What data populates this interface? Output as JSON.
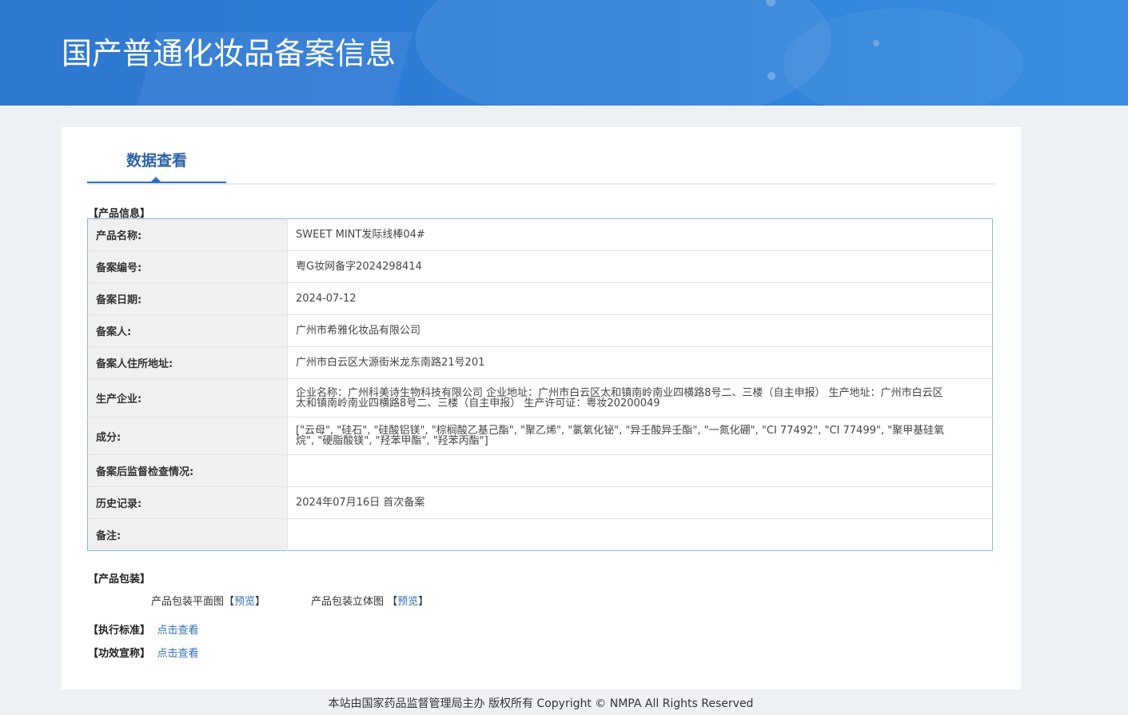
{
  "header": {
    "title": "国产普通化妆品备案信息"
  },
  "tabs": [
    {
      "label": "数据查看",
      "active": true
    }
  ],
  "product_info": {
    "section_label": "【产品信息】",
    "rows": [
      {
        "key": "产品名称:",
        "value": "SWEET MINT发际线棒04#"
      },
      {
        "key": "备案编号:",
        "value": "粤G妆网备字2024298414"
      },
      {
        "key": "备案日期:",
        "value": "2024-07-12"
      },
      {
        "key": "备案人:",
        "value": "广州市希雅化妆品有限公司"
      },
      {
        "key": "备案人住所地址:",
        "value": "广州市白云区大源街米龙东南路21号201"
      },
      {
        "key": "生产企业:",
        "value": "企业名称：广州科美诗生物科技有限公司 企业地址：广州市白云区太和镇南岭南业四横路8号二、三楼（自主申报） 生产地址：广州市白云区太和镇南岭南业四横路8号二、三楼（自主申报） 生产许可证：粤妆20200049"
      },
      {
        "key": "成分:",
        "value": "[\"云母\", \"硅石\", \"硅酸铝镁\", \"棕榈酸乙基己酯\", \"聚乙烯\", \"氯氧化铋\", \"异壬酸异壬酯\", \"一氮化硼\", \"CI 77492\", \"CI 77499\", \"聚甲基硅氧烷\", \"硬脂酸镁\", \"羟苯甲酯\", \"羟苯丙酯\"]"
      },
      {
        "key": "备案后监督检查情况:",
        "value": ""
      },
      {
        "key": "历史记录:",
        "value": "2024年07月16日 首次备案"
      },
      {
        "key": "备注:",
        "value": ""
      }
    ]
  },
  "packaging": {
    "section_label": "【产品包装】",
    "flat_label": "产品包装平面图",
    "flat_open": "【",
    "flat_link": "预览",
    "flat_close": "】",
    "stereo_label": "产品包装立体图",
    "stereo_open": "【",
    "stereo_link": "预览",
    "stereo_close": "】"
  },
  "standard": {
    "section_label": "【执行标准】",
    "link": "点击查看"
  },
  "efficacy": {
    "section_label": "【功效宣称】",
    "link": "点击查看"
  },
  "footer": {
    "text": "本站由国家药品监督管理局主办 版权所有 Copyright © NMPA All Rights Reserved"
  },
  "colors": {
    "header_blue": "#2f78cf",
    "tab_blue": "#2d63a8",
    "link_blue": "#2d6fb8",
    "table_border": "#8fb5dc",
    "key_bg": "#f0f0f0"
  }
}
